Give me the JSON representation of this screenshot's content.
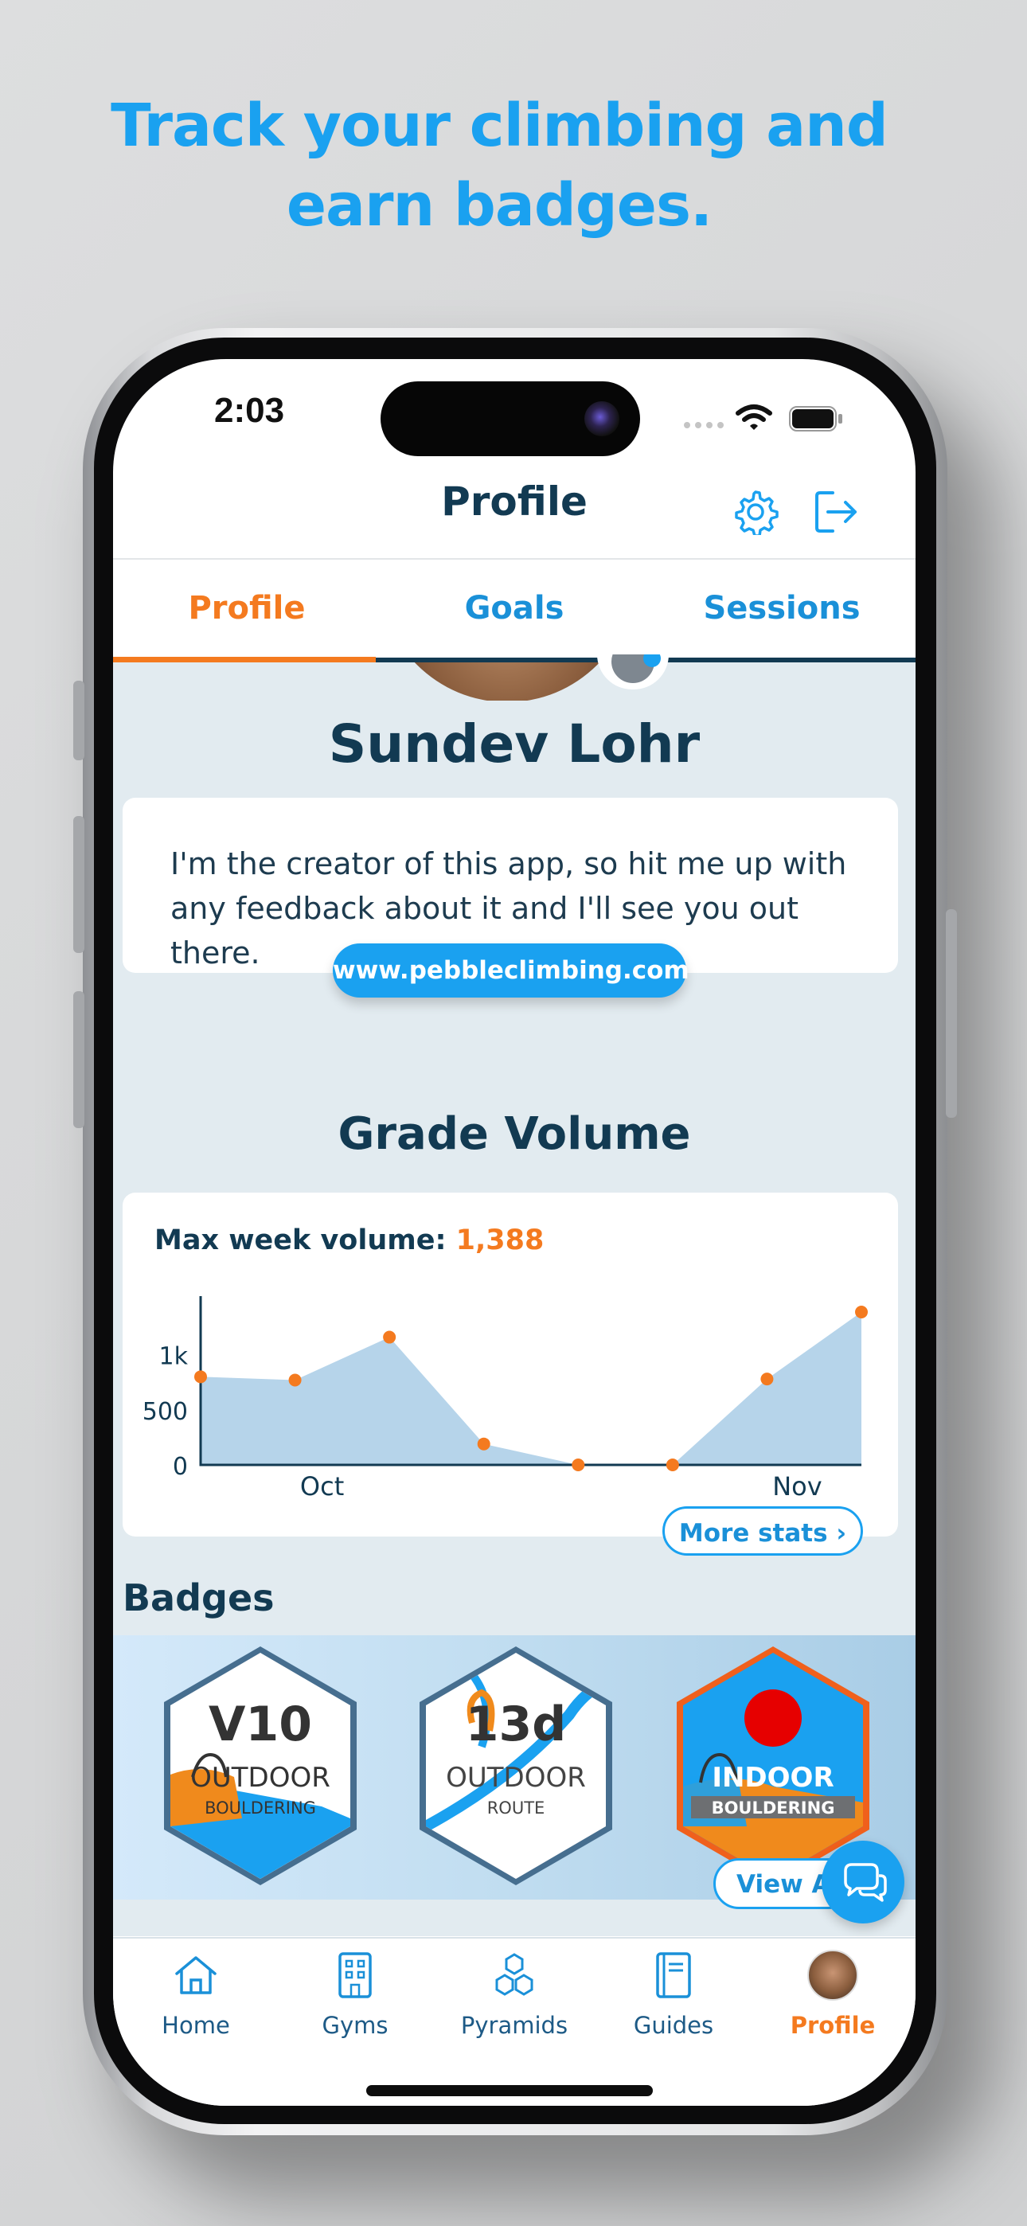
{
  "marketing": {
    "headline_line1": "Track your climbing and",
    "headline_line2": "earn badges."
  },
  "status_bar": {
    "time": "2:03"
  },
  "header": {
    "title": "Profile",
    "settings_icon": "gear-icon",
    "logout_icon": "logout-icon"
  },
  "tabs": [
    {
      "label": "Profile",
      "active": true
    },
    {
      "label": "Goals",
      "active": false
    },
    {
      "label": "Sessions",
      "active": false
    }
  ],
  "profile": {
    "name": "Sundev Lohr",
    "bio": "I'm the creator of this app, so hit me up with any feedback about it and I'll see you out there.",
    "website": "www.pebbleclimbing.com"
  },
  "grade_volume": {
    "title": "Grade Volume",
    "max_label": "Max week volume:",
    "max_value": "1,388",
    "more_stats_label": "More stats"
  },
  "chart_data": {
    "type": "area",
    "x": [
      "w1",
      "w2",
      "w3",
      "w4",
      "w5",
      "w6",
      "w7",
      "w8"
    ],
    "values": [
      800,
      770,
      1160,
      190,
      0,
      0,
      780,
      1388
    ],
    "x_tick_labels": [
      "Oct",
      "Nov"
    ],
    "y_tick_labels": [
      "0",
      "500",
      "1k"
    ],
    "ylim": [
      0,
      1388
    ],
    "grid": false,
    "colors": {
      "fill": "#b6d4ea",
      "point": "#f47a1f",
      "axis": "#123a52"
    }
  },
  "badges": {
    "title": "Badges",
    "view_all_label": "View All",
    "items": [
      {
        "title": "V10",
        "line1": "OUTDOOR",
        "line2": "BOULDERING",
        "variant": "blue-outdoor"
      },
      {
        "title": "13d",
        "line1": "OUTDOOR",
        "line2": "ROUTE",
        "variant": "white-outdoor"
      },
      {
        "title": "",
        "line1": "INDOOR",
        "line2": "BOULDERING",
        "variant": "orange-indoor"
      }
    ]
  },
  "bottom_nav": [
    {
      "label": "Home",
      "icon": "home-icon",
      "active": false
    },
    {
      "label": "Gyms",
      "icon": "building-icon",
      "active": false
    },
    {
      "label": "Pyramids",
      "icon": "hexagons-icon",
      "active": false
    },
    {
      "label": "Guides",
      "icon": "book-icon",
      "active": false
    },
    {
      "label": "Profile",
      "icon": "avatar",
      "active": true
    }
  ],
  "colors": {
    "accent": "#1aa1f0",
    "active": "#f47a1f",
    "navy": "#123a52",
    "content_bg": "#e2ebf0"
  }
}
